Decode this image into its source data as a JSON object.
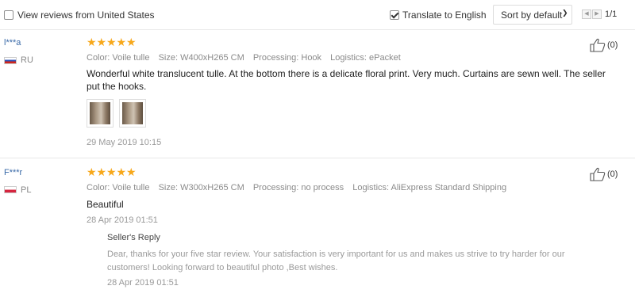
{
  "toolbar": {
    "filter_country_label": "View reviews from United States",
    "filter_country_checked": false,
    "translate_label": "Translate to English",
    "translate_checked": true,
    "sort_label": "Sort by default",
    "pagination": "1/1"
  },
  "reviews": [
    {
      "user": "l***a",
      "country": "RU",
      "rating": 5,
      "color": "Color: Voile tulle",
      "size": "Size: W400xH265 CM",
      "processing": "Processing: Hook",
      "logistics": "Logistics: ePacket",
      "text": "Wonderful white translucent tulle. At the bottom there is a delicate floral print. Very much. Curtains are sewn well. The seller put the hooks.",
      "photos": 2,
      "date": "29 May 2019 10:15",
      "likes": "(0)"
    },
    {
      "user": "F***r",
      "country": "PL",
      "rating": 5,
      "color": "Color: Voile tulle",
      "size": "Size: W300xH265 CM",
      "processing": "Processing: no process",
      "logistics": "Logistics: AliExpress Standard Shipping",
      "text": "Beautiful",
      "date": "28 Apr 2019 01:51",
      "likes": "(0)",
      "reply": {
        "title": "Seller's Reply",
        "text": "Dear, thanks for your five star review. Your satisfaction is very important for us and makes us strive to try harder for our customers! Looking forward to beautiful photo ,Best wishes.",
        "date": "28 Apr 2019 01:51"
      }
    }
  ]
}
